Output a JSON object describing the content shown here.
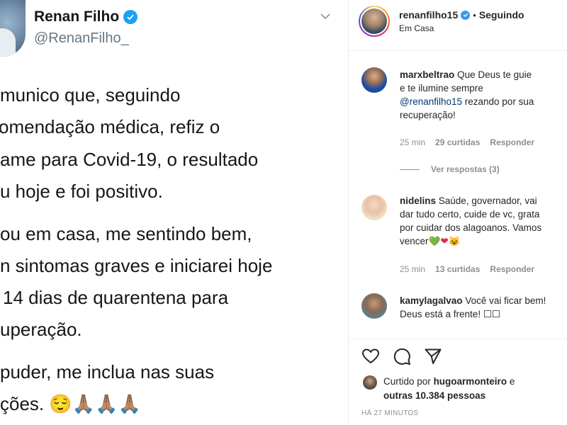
{
  "tweet": {
    "name": "Renan Filho",
    "handle": "@RenanFilho_",
    "lines": [
      "munico que, seguindo",
      "omendação médica, refiz o",
      "ame para Covid-19, o resultado",
      "u hoje e foi positivo.",
      "ou em casa, me sentindo bem,",
      "n sintomas graves e iniciarei hoje",
      "14 dias de quarentena para",
      "uperação.",
      "puder, me inclua nas suas",
      "ções. 😌🙏🏽🙏🏽🙏🏽"
    ]
  },
  "instagram": {
    "header": {
      "username": "renanfilho15",
      "separator": "•",
      "follow_status": "Seguindo",
      "location": "Em Casa"
    },
    "comments": [
      {
        "username": "marxbeltrao",
        "lines": [
          "Que Deus te guie",
          "e te ilumine sempre"
        ],
        "mention": "@renanfilho15",
        "mention_rest": " rezando por sua",
        "last_line": "recuperação!",
        "time": "25 min",
        "likes": "29 curtidas",
        "reply": "Responder",
        "view_replies": "Ver respostas (3)"
      },
      {
        "username": "nidelins",
        "lines": [
          "Saúde, governador, vai",
          "dar tudo certo, cuide de vc, grata",
          "por cuidar dos alagoanos. Vamos",
          "vencer"
        ],
        "emoji_green": "💚",
        "emoji_red": "❤",
        "emoji_cat": "😺",
        "time": "25 min",
        "likes": "13 curtidas",
        "reply": "Responder"
      },
      {
        "username": "kamylagalvao",
        "lines": [
          "Você vai ficar bem!",
          "Deus está a frente! ☐☐"
        ]
      }
    ],
    "liked_by": {
      "prefix": "Curtido por",
      "user": "hugoarmonteiro",
      "connector": "e",
      "others": "outras 10.384 pessoas"
    },
    "time_ago": "HÁ 27 MINUTOS"
  }
}
